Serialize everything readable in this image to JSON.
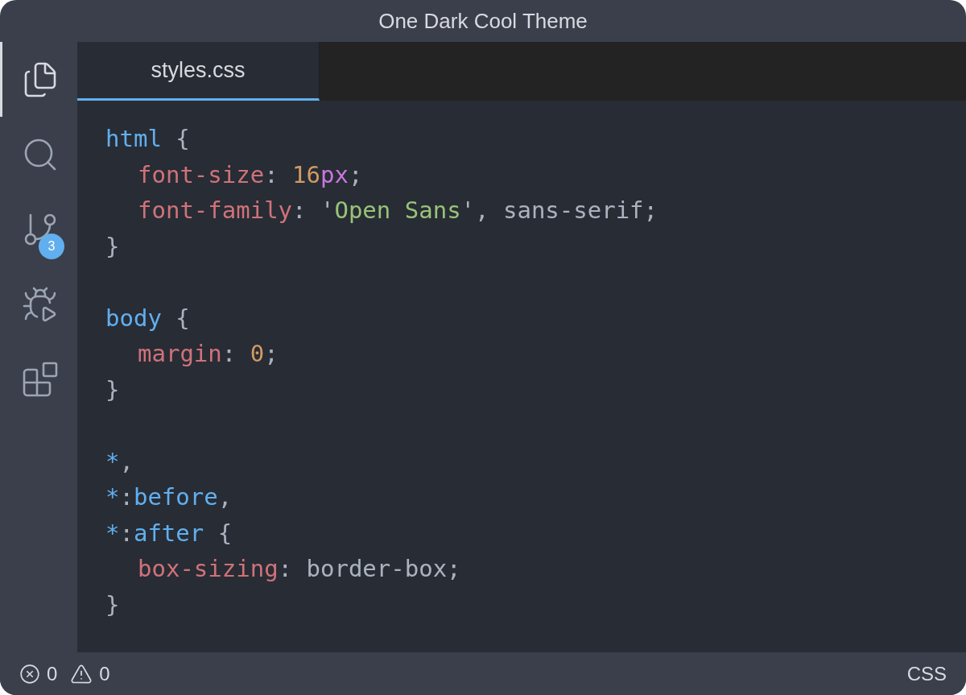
{
  "window": {
    "title": "One Dark Cool Theme"
  },
  "activity_bar": [
    {
      "kind": "files",
      "selected": true
    },
    {
      "kind": "search",
      "selected": false
    },
    {
      "kind": "source-control",
      "selected": false,
      "badge": "3"
    },
    {
      "kind": "run-debug",
      "selected": false
    },
    {
      "kind": "extensions",
      "selected": false
    }
  ],
  "tabs": [
    {
      "label": "styles.css",
      "selected": true
    }
  ],
  "editor": {
    "lines": [
      {
        "kind": "code",
        "indented": false,
        "tokens": [
          {
            "kind": "selector",
            "text": "html"
          },
          {
            "kind": "plain",
            "text": " {"
          }
        ]
      },
      {
        "kind": "code",
        "indented": true,
        "tokens": [
          {
            "kind": "property",
            "text": "font-size"
          },
          {
            "kind": "plain",
            "text": ": "
          },
          {
            "kind": "number",
            "text": "16"
          },
          {
            "kind": "unit",
            "text": "px"
          },
          {
            "kind": "plain",
            "text": ";"
          }
        ]
      },
      {
        "kind": "code",
        "indented": true,
        "tokens": [
          {
            "kind": "property",
            "text": "font-family"
          },
          {
            "kind": "plain",
            "text": ": '"
          },
          {
            "kind": "string",
            "text": "Open Sans"
          },
          {
            "kind": "plain",
            "text": "', sans-serif;"
          }
        ]
      },
      {
        "kind": "code",
        "indented": false,
        "tokens": [
          {
            "kind": "plain",
            "text": "}"
          }
        ]
      },
      {
        "kind": "blank"
      },
      {
        "kind": "code",
        "indented": false,
        "tokens": [
          {
            "kind": "selector",
            "text": "body"
          },
          {
            "kind": "plain",
            "text": " {"
          }
        ]
      },
      {
        "kind": "code",
        "indented": true,
        "tokens": [
          {
            "kind": "property",
            "text": "margin"
          },
          {
            "kind": "plain",
            "text": ": "
          },
          {
            "kind": "number",
            "text": "0"
          },
          {
            "kind": "plain",
            "text": ";"
          }
        ]
      },
      {
        "kind": "code",
        "indented": false,
        "tokens": [
          {
            "kind": "plain",
            "text": "}"
          }
        ]
      },
      {
        "kind": "blank"
      },
      {
        "kind": "code",
        "indented": false,
        "tokens": [
          {
            "kind": "selector",
            "text": "*"
          },
          {
            "kind": "plain",
            "text": ","
          }
        ]
      },
      {
        "kind": "code",
        "indented": false,
        "tokens": [
          {
            "kind": "selector",
            "text": "*"
          },
          {
            "kind": "plain",
            "text": ":"
          },
          {
            "kind": "selector",
            "text": "before"
          },
          {
            "kind": "plain",
            "text": ","
          }
        ]
      },
      {
        "kind": "code",
        "indented": false,
        "tokens": [
          {
            "kind": "selector",
            "text": "*"
          },
          {
            "kind": "plain",
            "text": ":"
          },
          {
            "kind": "selector",
            "text": "after"
          },
          {
            "kind": "plain",
            "text": " {"
          }
        ]
      },
      {
        "kind": "code",
        "indented": true,
        "tokens": [
          {
            "kind": "property",
            "text": "box-sizing"
          },
          {
            "kind": "plain",
            "text": ": border-box;"
          }
        ]
      },
      {
        "kind": "code",
        "indented": false,
        "tokens": [
          {
            "kind": "plain",
            "text": "}"
          }
        ]
      }
    ]
  },
  "status_bar": {
    "errors": "0",
    "warnings": "0",
    "language": "CSS"
  }
}
